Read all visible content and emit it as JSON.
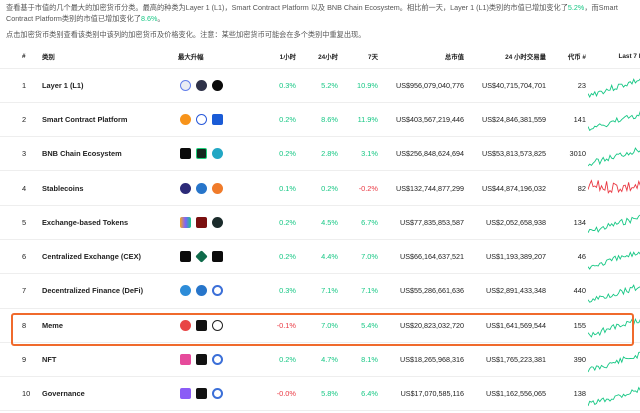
{
  "intro": {
    "line1_a": "查看基于市值的几个最大的加密货币分类。最高的种类为Layer 1 (L1)，Smart Contract Platform 以及 BNB Chain Ecosystem。相比前一天，Layer 1 (L1)类别的市值已增加变化了",
    "line1_pct": "5.2%",
    "line1_b": "，而Smart Contract Platform类别的市值已增加变化了",
    "line1_pct2": "8.6%",
    "line1_end": "。",
    "note": "点击加密货币类别查看该类别中该列的加密货币及价格变化。注意：某些加密货币可能会在多个类别中重复出现。"
  },
  "headers": {
    "rank": "#",
    "name": "类别",
    "top_gainers": "最大升幅",
    "h1": "1小时",
    "h24": "24小时",
    "d7": "7天",
    "market_cap": "总市值",
    "volume": "24 小时交易量",
    "num_coins": "代币 #",
    "last7": "Last 7 Days"
  },
  "colors": {
    "positive": "#16c784",
    "negative": "#ea3943",
    "highlight": "#f06a2c"
  },
  "rows": [
    {
      "rank": "1",
      "name": "Layer 1 (L1)",
      "coins": [
        "eth-icon",
        "cosmos-icon",
        "flow-icon"
      ],
      "h1": "0.3%",
      "h1_dir": "pos",
      "h24": "5.2%",
      "h24_dir": "pos",
      "d7": "10.9%",
      "d7_dir": "pos",
      "market_cap": "US$956,079,040,776",
      "volume": "US$40,715,704,701",
      "num_coins": "23",
      "spark_dir": "pos"
    },
    {
      "rank": "2",
      "name": "Smart Contract Platform",
      "coins": [
        "coin-orange-icon",
        "yo-icon",
        "blue-square-icon"
      ],
      "h1": "0.2%",
      "h1_dir": "pos",
      "h24": "8.6%",
      "h24_dir": "pos",
      "d7": "11.9%",
      "d7_dir": "pos",
      "market_cap": "US$403,567,219,446",
      "volume": "US$24,846,381,559",
      "num_coins": "141",
      "spark_dir": "pos"
    },
    {
      "rank": "3",
      "name": "BNB Chain Ecosystem",
      "coins": [
        "black-square-icon",
        "green-square-icon",
        "teal-hex-icon"
      ],
      "h1": "0.2%",
      "h1_dir": "pos",
      "h24": "2.8%",
      "h24_dir": "pos",
      "d7": "3.1%",
      "d7_dir": "pos",
      "market_cap": "US$256,848,624,694",
      "volume": "US$53,813,573,825",
      "num_coins": "3010",
      "spark_dir": "pos"
    },
    {
      "rank": "4",
      "name": "Stablecoins",
      "coins": [
        "purple-circle-icon",
        "blue-circle-icon",
        "orange-circle-icon"
      ],
      "h1": "0.1%",
      "h1_dir": "pos",
      "h24": "0.2%",
      "h24_dir": "pos",
      "d7": "-0.2%",
      "d7_dir": "neg",
      "market_cap": "US$132,744,877,299",
      "volume": "US$44,874,196,032",
      "num_coins": "82",
      "spark_dir": "neg"
    },
    {
      "rank": "5",
      "name": "Exchange-based Tokens",
      "coins": [
        "colorful-icon",
        "red-square-icon",
        "dark-circle-icon"
      ],
      "h1": "0.2%",
      "h1_dir": "pos",
      "h24": "4.5%",
      "h24_dir": "pos",
      "d7": "6.7%",
      "d7_dir": "pos",
      "market_cap": "US$77,835,853,587",
      "volume": "US$2,052,658,938",
      "num_coins": "134",
      "spark_dir": "pos"
    },
    {
      "rank": "6",
      "name": "Centralized Exchange (CEX)",
      "coins": [
        "black-square-icon",
        "green-diamond-icon",
        "w-square-icon"
      ],
      "h1": "0.2%",
      "h1_dir": "pos",
      "h24": "4.4%",
      "h24_dir": "pos",
      "d7": "7.0%",
      "d7_dir": "pos",
      "market_cap": "US$66,164,637,521",
      "volume": "US$1,193,389,207",
      "num_coins": "46",
      "spark_dir": "pos"
    },
    {
      "rank": "7",
      "name": "Decentralized Finance (DeFi)",
      "coins": [
        "teal-circle-icon",
        "blue-circle-icon",
        "ring-icon"
      ],
      "h1": "0.3%",
      "h1_dir": "pos",
      "h24": "7.1%",
      "h24_dir": "pos",
      "d7": "7.1%",
      "d7_dir": "pos",
      "market_cap": "US$55,286,661,636",
      "volume": "US$2,891,433,348",
      "num_coins": "440",
      "spark_dir": "pos"
    },
    {
      "rank": "8",
      "name": "Meme",
      "coins": [
        "red-face-icon",
        "dark-square-icon",
        "clock-icon"
      ],
      "h1": "-0.1%",
      "h1_dir": "neg",
      "h24": "7.0%",
      "h24_dir": "pos",
      "d7": "5.4%",
      "d7_dir": "pos",
      "market_cap": "US$20,823,032,720",
      "volume": "US$1,641,569,544",
      "num_coins": "155",
      "spark_dir": "pos"
    },
    {
      "rank": "9",
      "name": "NFT",
      "coins": [
        "pink-square-icon",
        "dark-square-icon",
        "ring-icon"
      ],
      "h1": "0.2%",
      "h1_dir": "pos",
      "h24": "4.7%",
      "h24_dir": "pos",
      "d7": "8.1%",
      "d7_dir": "pos",
      "market_cap": "US$18,265,968,316",
      "volume": "US$1,765,223,381",
      "num_coins": "390",
      "spark_dir": "pos"
    },
    {
      "rank": "10",
      "name": "Governance",
      "coins": [
        "purple-square-icon",
        "dark-square-icon",
        "ring-icon"
      ],
      "h1": "-0.0%",
      "h1_dir": "neg",
      "h24": "5.8%",
      "h24_dir": "pos",
      "d7": "6.4%",
      "d7_dir": "pos",
      "market_cap": "US$17,070,585,116",
      "volume": "US$1,162,556,065",
      "num_coins": "138",
      "spark_dir": "pos"
    }
  ]
}
